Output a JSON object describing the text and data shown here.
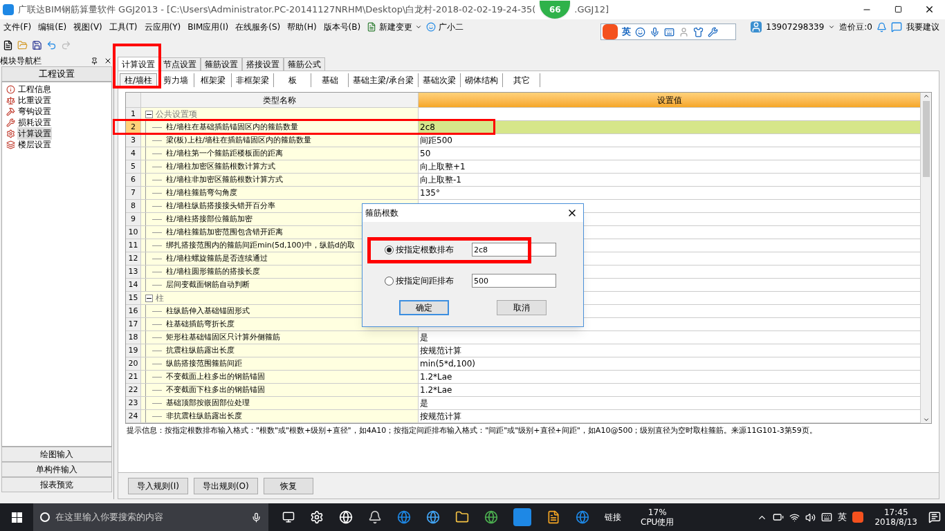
{
  "window": {
    "title": "广联达BIM钢筋算量软件 GGJ2013 - [C:\\Users\\Administrator.PC-20141127NRHM\\Desktop\\白龙村-2018-02-02-19-24-35(",
    "title_tail": ".GGJ12]",
    "badge": "66"
  },
  "menu": [
    "文件(F)",
    "编辑(E)",
    "视图(V)",
    "工具(T)",
    "云应用(Y)",
    "BIM应用(I)",
    "在线服务(S)",
    "帮助(H)",
    "版本号(B)"
  ],
  "menu_extra": [
    {
      "label": "新建变更"
    },
    {
      "label": "广小二"
    }
  ],
  "account": {
    "user": "13907298339",
    "beans": "造价豆:0",
    "suggest": "我要建议"
  },
  "ime": {
    "mode": "英"
  },
  "nav": {
    "title": "模块导航栏",
    "section": "工程设置",
    "items": [
      {
        "label": "工程信息",
        "selected": false
      },
      {
        "label": "比重设置",
        "selected": false
      },
      {
        "label": "弯钩设置",
        "selected": false
      },
      {
        "label": "损耗设置",
        "selected": false
      },
      {
        "label": "计算设置",
        "selected": true
      },
      {
        "label": "楼层设置",
        "selected": false
      }
    ],
    "bottom": [
      "绘图输入",
      "单构件输入",
      "报表预览"
    ]
  },
  "tabs": [
    {
      "label": "计算设置",
      "selected": true
    },
    {
      "label": "节点设置",
      "selected": false
    },
    {
      "label": "箍筋设置",
      "selected": false
    },
    {
      "label": "搭接设置",
      "selected": false
    },
    {
      "label": "箍筋公式",
      "selected": false
    }
  ],
  "subtabs": [
    {
      "label": "柱/墙柱",
      "selected": true
    },
    {
      "label": "剪力墙",
      "selected": false
    },
    {
      "label": "框架梁",
      "selected": false
    },
    {
      "label": "非框架梁",
      "selected": false
    },
    {
      "label": "板",
      "selected": false
    },
    {
      "label": "基础",
      "selected": false
    },
    {
      "label": "基础主梁/承台梁",
      "selected": false
    },
    {
      "label": "基础次梁",
      "selected": false
    },
    {
      "label": "砌体结构",
      "selected": false
    },
    {
      "label": "其它",
      "selected": false
    }
  ],
  "table": {
    "columns": [
      "类型名称",
      "设置值"
    ],
    "rows": [
      {
        "no": "1",
        "kind": "group",
        "name": "公共设置项",
        "selected": false
      },
      {
        "no": "2",
        "kind": "item",
        "name": "柱/墙柱在基础插筋锚固区内的箍筋数量",
        "value": "2c8",
        "selected": true
      },
      {
        "no": "3",
        "kind": "item",
        "name": "梁(板)上柱/墙柱在插筋锚固区内的箍筋数量",
        "value": "间距500",
        "selected": false
      },
      {
        "no": "4",
        "kind": "item",
        "name": "柱/墙柱第一个箍筋距楼板面的距离",
        "value": "50",
        "selected": false
      },
      {
        "no": "5",
        "kind": "item",
        "name": "柱/墙柱加密区箍筋根数计算方式",
        "value": "向上取整+1",
        "selected": false
      },
      {
        "no": "6",
        "kind": "item",
        "name": "柱/墙柱非加密区箍筋根数计算方式",
        "value": "向上取整-1",
        "selected": false
      },
      {
        "no": "7",
        "kind": "item",
        "name": "柱/墙柱箍筋弯勾角度",
        "value": "135°",
        "selected": false
      },
      {
        "no": "8",
        "kind": "item",
        "name": "柱/墙柱纵筋搭接接头错开百分率",
        "selected": false
      },
      {
        "no": "9",
        "kind": "item",
        "name": "柱/墙柱搭接部位箍筋加密",
        "selected": false
      },
      {
        "no": "10",
        "kind": "item",
        "name": "柱/墙柱箍筋加密范围包含错开距离",
        "selected": false
      },
      {
        "no": "11",
        "kind": "item",
        "name": "绑扎搭接范围内的箍筋间距min(5d,100)中，纵筋d的取",
        "selected": false
      },
      {
        "no": "12",
        "kind": "item",
        "name": "柱/墙柱螺旋箍筋是否连续通过",
        "selected": false
      },
      {
        "no": "13",
        "kind": "item",
        "name": "柱/墙柱圆形箍筋的搭接长度",
        "selected": false
      },
      {
        "no": "14",
        "kind": "item",
        "name": "层间变截面钢筋自动判断",
        "selected": false
      },
      {
        "no": "15",
        "kind": "group",
        "name": "柱",
        "selected": false
      },
      {
        "no": "16",
        "kind": "item",
        "name": "柱纵筋伸入基础锚固形式",
        "selected": false
      },
      {
        "no": "17",
        "kind": "item",
        "name": "柱基础插筋弯折长度",
        "selected": false
      },
      {
        "no": "18",
        "kind": "item",
        "name": "矩形柱基础锚固区只计算外侧箍筋",
        "value": "是",
        "selected": false
      },
      {
        "no": "19",
        "kind": "item",
        "name": "抗震柱纵筋露出长度",
        "value": "按规范计算",
        "selected": false
      },
      {
        "no": "20",
        "kind": "item",
        "name": "纵筋搭接范围箍筋间距",
        "value": "min(5*d,100)",
        "selected": false
      },
      {
        "no": "21",
        "kind": "item",
        "name": "不变截面上柱多出的钢筋锚固",
        "value": "1.2*Lae",
        "selected": false
      },
      {
        "no": "22",
        "kind": "item",
        "name": "不变截面下柱多出的钢筋锚固",
        "value": "1.2*Lae",
        "selected": false
      },
      {
        "no": "23",
        "kind": "item",
        "name": "基础顶部按嵌固部位处理",
        "value": "是",
        "selected": false
      },
      {
        "no": "24",
        "kind": "item",
        "name": "非抗震柱纵筋露出长度",
        "value": "按规范计算",
        "selected": false
      }
    ]
  },
  "hint": "提示信息：按指定根数排布输入格式：\"根数\"或\"根数+级别+直径\"，如4A10；按指定间距排布输入格式：\"间距\"或\"级别+直径+间距\"，如A10@500；级别直径为空时取柱箍筋。来源11G101-3第59页。",
  "actions": [
    "导入规则(I)",
    "导出规则(O)",
    "恢复"
  ],
  "dialog": {
    "title": "箍筋根数",
    "options": [
      {
        "label": "按指定根数排布",
        "value": "2c8",
        "selected": true
      },
      {
        "label": "按指定间距排布",
        "value": "500",
        "selected": false
      }
    ],
    "ok": "确定",
    "cancel": "取消"
  },
  "taskbar": {
    "search": "在这里输入你要搜索的内容",
    "link": "链接",
    "cpu": "17%",
    "cpu_label": "CPU使用",
    "ime": "英",
    "time": "17:45",
    "date": "2018/8/13"
  }
}
